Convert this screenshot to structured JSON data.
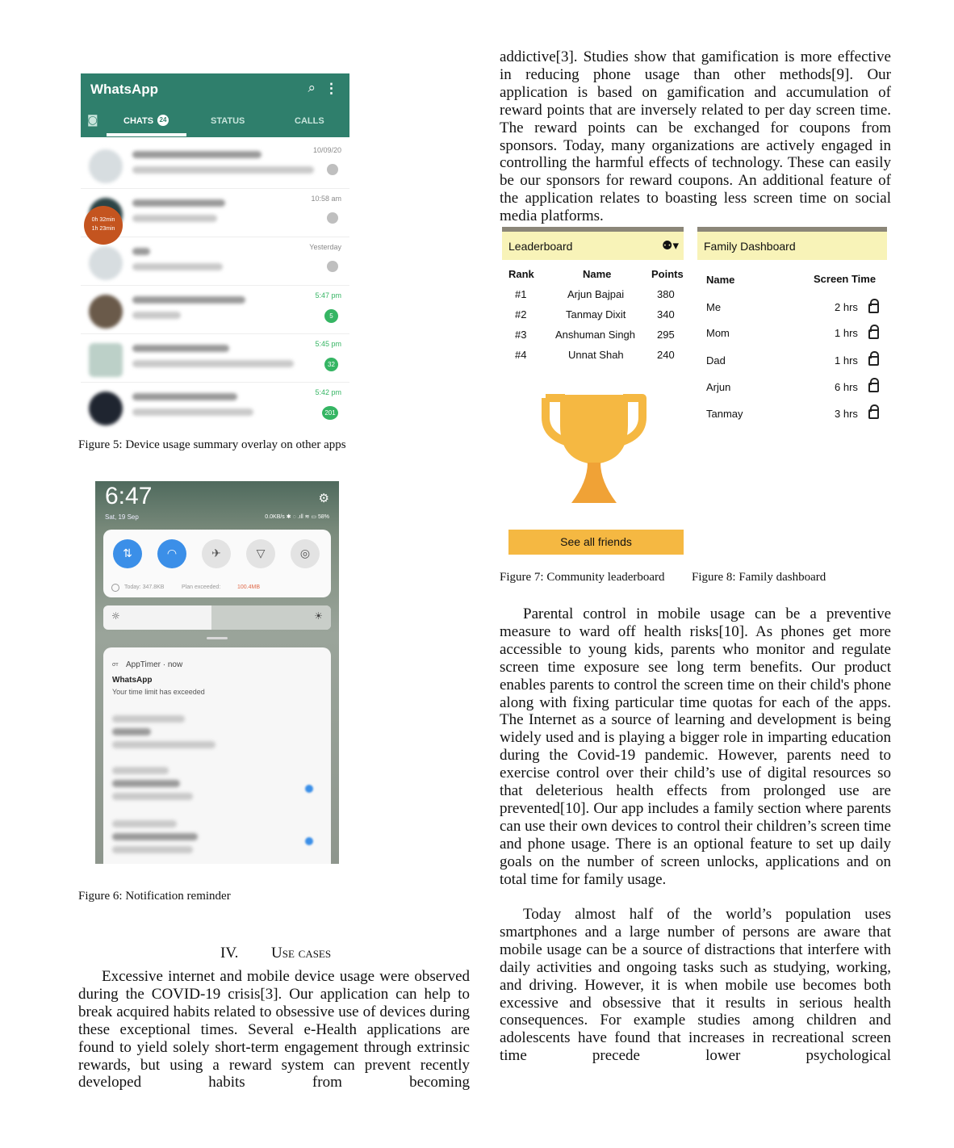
{
  "left_col": {
    "fig5": {
      "app_title": "WhatsApp",
      "tabs": [
        "CHATS",
        "STATUS",
        "CALLS"
      ],
      "chats_badge": "24",
      "overlay_line1": "0h 32min",
      "overlay_line2": "1h 23min",
      "rows": [
        {
          "time": "10/09/20",
          "badge": "",
          "time_green": false
        },
        {
          "time": "10:58 am",
          "badge": "",
          "time_green": false
        },
        {
          "time": "Yesterday",
          "badge": "",
          "time_green": false
        },
        {
          "time": "5:47 pm",
          "badge": "5",
          "time_green": true
        },
        {
          "time": "5:45 pm",
          "badge": "32",
          "time_green": true
        },
        {
          "time": "5:42 pm",
          "badge": "201",
          "time_green": true
        }
      ]
    },
    "fig5_caption": "Figure 5: Device usage summary overlay on other apps",
    "fig6": {
      "clock": "6:47",
      "date": "Sat, 19 Sep",
      "status": "0.0KB/s ✱ ◌ .ıll ≋ ▭ 58%",
      "data_today": "Today: 347.8KB",
      "plan_label": "Plan exceeded:",
      "plan_value": "100.4MB",
      "notif_app": "AppTimer · now",
      "notif_title": "WhatsApp",
      "notif_text": "Your time limit has exceeded"
    },
    "fig6_caption": "Figure 6: Notification reminder",
    "section_number": "IV.",
    "section_title": "Use cases",
    "para1": "Excessive internet and mobile device usage were observed during the COVID-19 crisis[3]. Our application can help to break acquired habits related to obsessive use of devices during these exceptional times. Several e-Health applications are found to yield solely short-term engagement through extrinsic rewards, but using a reward system can prevent recently developed habits from becoming"
  },
  "right_col": {
    "para_top": "addictive[3]. Studies show that gamification is more effective in reducing phone usage than other methods[9]. Our application is based on gamification and accumulation of reward points that are inversely related to per day screen time. The reward points can be exchanged for coupons from sponsors. Today, many organizations are actively engaged in controlling the harmful effects of technology. These can easily be our sponsors for reward coupons. An additional feature of the application relates to boasting less screen time on social media platforms.",
    "leaderboard": {
      "title": "Leaderboard",
      "headers": [
        "Rank",
        "Name",
        "Points"
      ],
      "rows": [
        [
          "#1",
          "Arjun Bajpai",
          "380"
        ],
        [
          "#2",
          "Tanmay Dixit",
          "340"
        ],
        [
          "#3",
          "Anshuman Singh",
          "295"
        ],
        [
          "#4",
          "Unnat Shah",
          "240"
        ]
      ],
      "button": "See all friends"
    },
    "family": {
      "title": "Family Dashboard",
      "headers": [
        "Name",
        "Screen Time"
      ],
      "rows": [
        [
          "Me",
          "2 hrs"
        ],
        [
          "Mom",
          "1 hrs"
        ],
        [
          "Dad",
          "1 hrs"
        ],
        [
          "Arjun",
          "6 hrs"
        ],
        [
          "Tanmay",
          "3 hrs"
        ]
      ]
    },
    "fig7_caption": "Figure 7: Community leaderboard",
    "fig8_caption": "Figure 8: Family dashboard",
    "para2": "Parental control in mobile usage can be a preventive measure to ward off health risks[10]. As phones get more accessible to young kids, parents who monitor and regulate screen time exposure see long term benefits. Our product enables parents to control the screen time on their child's phone along with fixing particular time quotas for each of the apps. The Internet as a source of learning and development is being widely used and is playing a bigger role in imparting education during the Covid-19 pandemic. However, parents need to exercise control over their child’s use of digital resources so that deleterious health effects from prolonged use are prevented[10]. Our app includes a family section where parents can use their own devices to control their children’s screen time and phone usage. There is an optional feature to set up daily goals on the number of screen unlocks, applications and on total time for family usage.",
    "para3": "Today almost half of the world’s population uses smartphones and a large number of persons are aware that mobile usage can be a source of distractions that interfere with daily activities and ongoing tasks such as studying, working, and driving. However, it is when mobile use becomes both excessive and obsessive that it results in serious health consequences. For example studies among children and adolescents have found that increases in recreational screen time precede lower psychological"
  },
  "colors": {
    "whatsapp_green": "#2f7f6c",
    "accent_yellow": "#f5b842",
    "header_yellow": "#f8f3b8"
  }
}
